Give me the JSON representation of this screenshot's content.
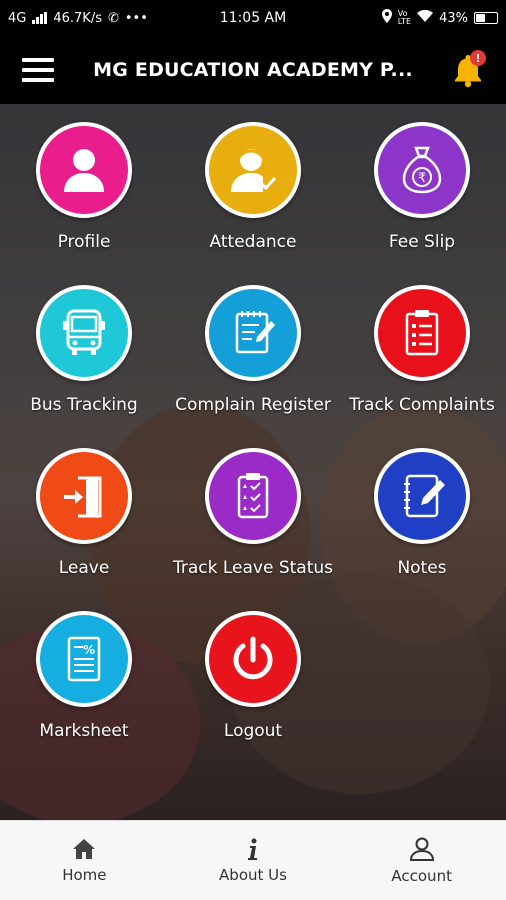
{
  "status_bar": {
    "network": "4G",
    "speed": "46.7K/s",
    "time": "11:05 AM",
    "battery": "43%",
    "more": "•••"
  },
  "header": {
    "title": "MG EDUCATION ACADEMY P...",
    "notification_badge": "!"
  },
  "menu": {
    "profile": "Profile",
    "attendance": "Attedance",
    "fee_slip": "Fee Slip",
    "bus_tracking": "Bus Tracking",
    "complain_register": "Complain Register",
    "track_complaints": "Track Complaints",
    "leave": "Leave",
    "track_leave_status": "Track Leave Status",
    "notes": "Notes",
    "marksheet": "Marksheet",
    "logout": "Logout"
  },
  "colors": {
    "profile": "#e91e8c",
    "attendance": "#e8ad0e",
    "fee_slip": "#8e35c9",
    "bus_tracking": "#1ec8d6",
    "complain_register": "#159fd8",
    "track_complaints": "#e8101b",
    "leave": "#f04a16",
    "track_leave_status": "#9a2bc7",
    "notes": "#1f3fc4",
    "marksheet": "#16aee0",
    "logout": "#e8141c",
    "bell": "#f4b400"
  },
  "bottom_nav": {
    "home": "Home",
    "about": "About Us",
    "account": "Account"
  }
}
